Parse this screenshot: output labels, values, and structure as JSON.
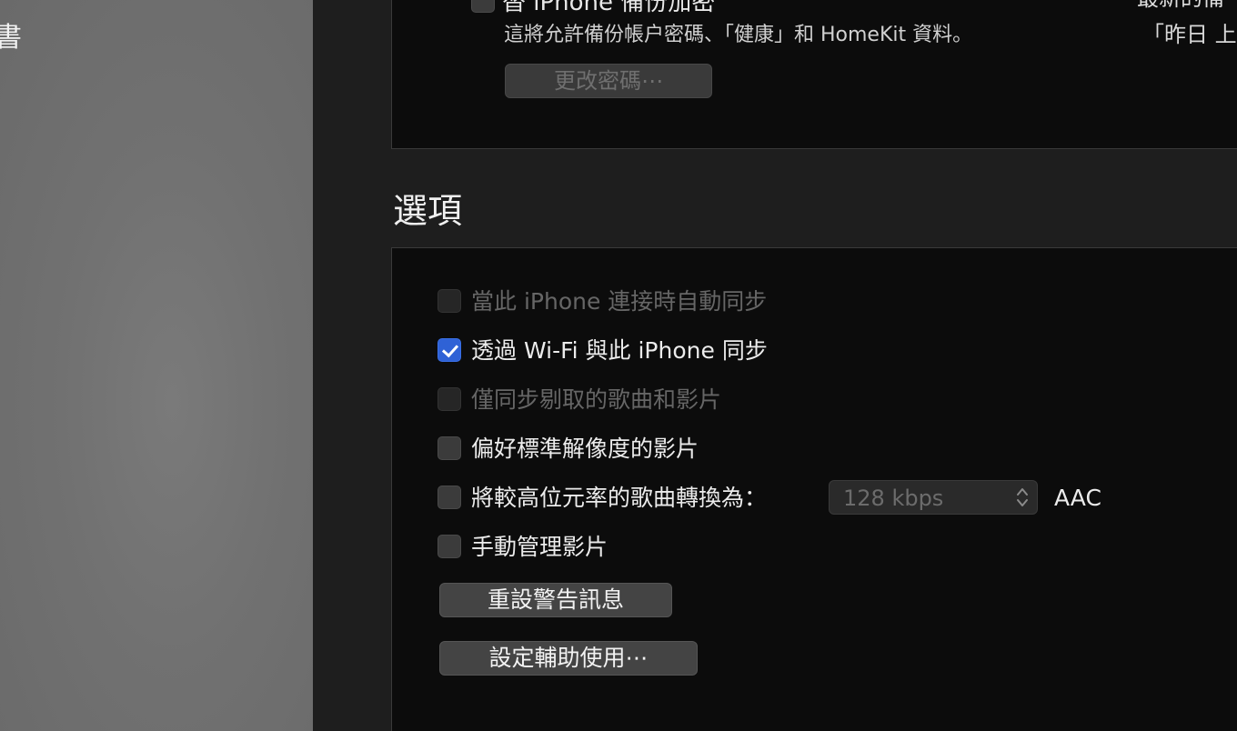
{
  "sidebar": {
    "cut_label": "書"
  },
  "backup": {
    "encrypt_label": "替 iPhone 備份加密",
    "encrypt_desc": "這將允許備份帳户密碼、「健康」和 HomeKit 資料。",
    "change_password_label": "更改密碼⋯",
    "latest_backup_label": "最新的備",
    "latest_backup_value": "「昨日 上"
  },
  "options": {
    "title": "選項",
    "items": [
      {
        "label": "當此 iPhone 連接時自動同步",
        "checked": false,
        "enabled": false
      },
      {
        "label": "透過 Wi-Fi 與此 iPhone 同步",
        "checked": true,
        "enabled": true
      },
      {
        "label": "僅同步剔取的歌曲和影片",
        "checked": false,
        "enabled": false
      },
      {
        "label": "偏好標準解像度的影片",
        "checked": false,
        "enabled": true
      },
      {
        "label": "將較高位元率的歌曲轉換為：",
        "checked": false,
        "enabled": true
      },
      {
        "label": "手動管理影片",
        "checked": false,
        "enabled": true
      }
    ],
    "bitrate_value": "128 kbps",
    "format_label": "AAC",
    "reset_warnings_label": "重設警告訊息",
    "accessibility_label": "設定輔助使用⋯"
  },
  "colors": {
    "checkbox_checked": "#2f62d6",
    "panel_bg": "#0c0c0c",
    "window_bg": "#1e1e1e"
  }
}
